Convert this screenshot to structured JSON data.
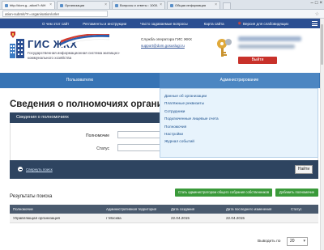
{
  "browser": {
    "tabs": [
      {
        "title": "http://dom.g...ationl?=NH",
        "active": true
      },
      {
        "title": "Организации",
        "active": false
      },
      {
        "title": "Вопросы и ответы : 1000.РФ",
        "active": false
      },
      {
        "title": "Общая информация",
        "active": false
      }
    ],
    "url": "ation-submit/?r=organisation/orler"
  },
  "topnav": {
    "items": [
      "О чем этот сайт",
      "Регламенты и инструкции",
      "Часто задаваемые вопросы",
      "Карта сайта"
    ],
    "vision_label": "Версия для слабовидящих"
  },
  "header": {
    "logo_title": "ГИС ЖКХ",
    "logo_subtitle": "Государственная информационная система жилищно-коммунального хозяйства",
    "support_title": "Служба оператора ГИС ЖКХ",
    "support_email": "support@dom.gosuslugi.ru",
    "logout_label": "Выйти"
  },
  "mainnav": {
    "items": [
      "Пользователю",
      "Администрирование"
    ]
  },
  "dropdown": {
    "items": [
      "Данные об организации",
      "Платёжные реквизиты",
      "Сотрудники",
      "Подключенные лицевые счета",
      "Полномочия",
      "Настройки",
      "Журнал событий"
    ]
  },
  "page": {
    "title": "Сведения о полномочиях организации",
    "panel_title": "Сведения о полномочиях",
    "fields": {
      "authority_label": "Полномочие",
      "status_label": "Статус"
    },
    "collapse_label": "Свернуть поиск",
    "find_label": "Найти",
    "action_primary": "Стать администратором общего собрания собственников",
    "action_secondary": "Добавить полномочие",
    "results_title": "Результаты поиска",
    "table": {
      "headers": [
        "Полномочие",
        "Административная территория",
        "Дата создания",
        "Дата последнего изменения",
        "Статус"
      ],
      "rows": [
        [
          "Управляющая организация",
          "г Москва",
          "22.04.2015",
          "22.04.2015",
          ""
        ]
      ]
    },
    "per_page_label": "Выводить по",
    "per_page_value": "20"
  }
}
